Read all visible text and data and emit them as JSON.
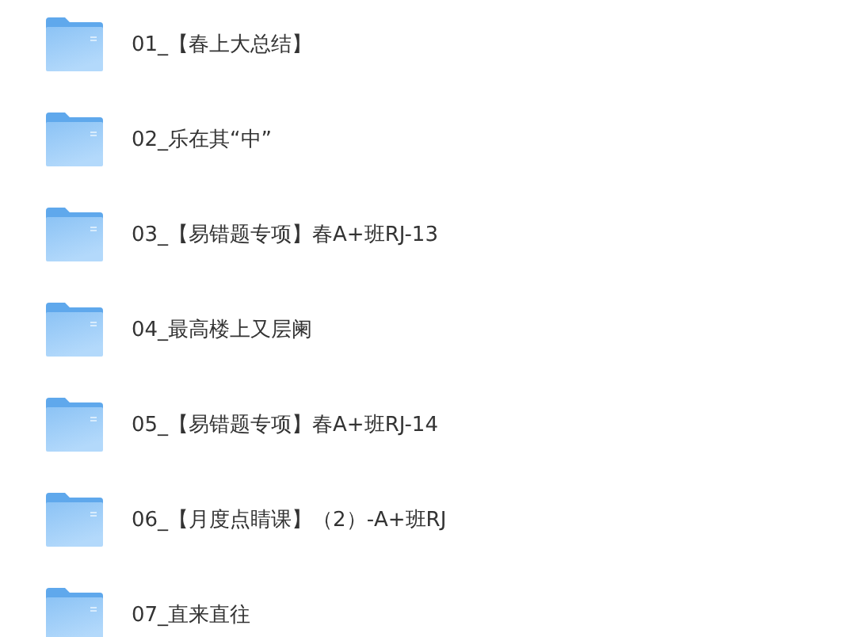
{
  "folders": [
    {
      "name": "01_【春上大总结】"
    },
    {
      "name": "02_乐在其“中”"
    },
    {
      "name": "03_【易错题专项】春A+班RJ-13"
    },
    {
      "name": "04_最高楼上又层阑"
    },
    {
      "name": "05_【易错题专项】春A+班RJ-14"
    },
    {
      "name": "06_【月度点睛课】（2）-A+班RJ"
    },
    {
      "name": "07_直来直往"
    }
  ]
}
